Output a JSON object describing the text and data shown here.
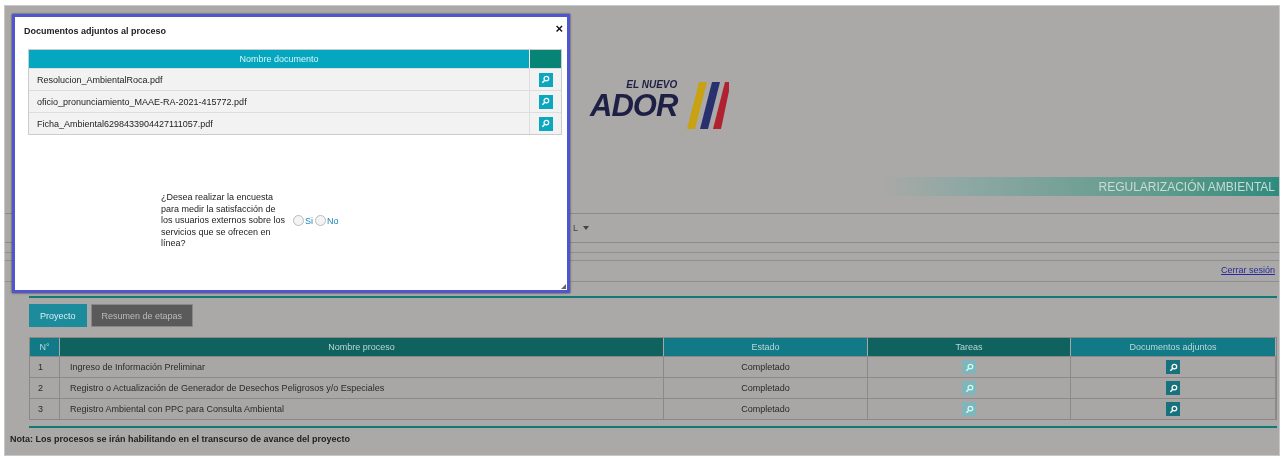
{
  "modal": {
    "title": "Documentos adjuntos al proceso",
    "close": "×",
    "columns": [
      "Nombre documento"
    ],
    "rows": [
      {
        "name": "Resolucion_AmbientalRoca.pdf"
      },
      {
        "name": "oficio_pronunciamiento_MAAE-RA-2021-415772.pdf"
      },
      {
        "name": "Ficha_Ambiental6298433904427111057.pdf"
      }
    ],
    "survey": {
      "question": "¿Desea realizar la encuesta para medir la satisfacción de los usuarios externos sobre los servicios que se ofrecen en línea?",
      "options": [
        {
          "label": "Si",
          "selected": false
        },
        {
          "label": "No",
          "selected": false
        }
      ]
    }
  },
  "header": {
    "logo_tagline": "EL NUEVO",
    "logo_word": "ADOR",
    "banner": "REGULARIZACIÓN AMBIENTAL",
    "menu_label": "L",
    "logout": "Cerrar sesión"
  },
  "tabs": [
    {
      "label": "Proyecto",
      "selected": true
    },
    {
      "label": "Resumen de etapas",
      "selected": false
    }
  ],
  "processes": {
    "columns": [
      "N°",
      "Nombre proceso",
      "Estado",
      "Tareas",
      "Documentos adjuntos"
    ],
    "rows": [
      {
        "number": "1",
        "name": "Ingreso de Información Preliminar",
        "status": "Completado"
      },
      {
        "number": "2",
        "name": "Registro o Actualización de Generador de Desechos Peligrosos y/o Especiales",
        "status": "Completado"
      },
      {
        "number": "3",
        "name": "Registro Ambiental con PPC para Consulta Ambiental",
        "status": "Completado"
      }
    ]
  },
  "note": "Nota: Los procesos se irán habilitando en el transcurso de avance del proyecto"
}
